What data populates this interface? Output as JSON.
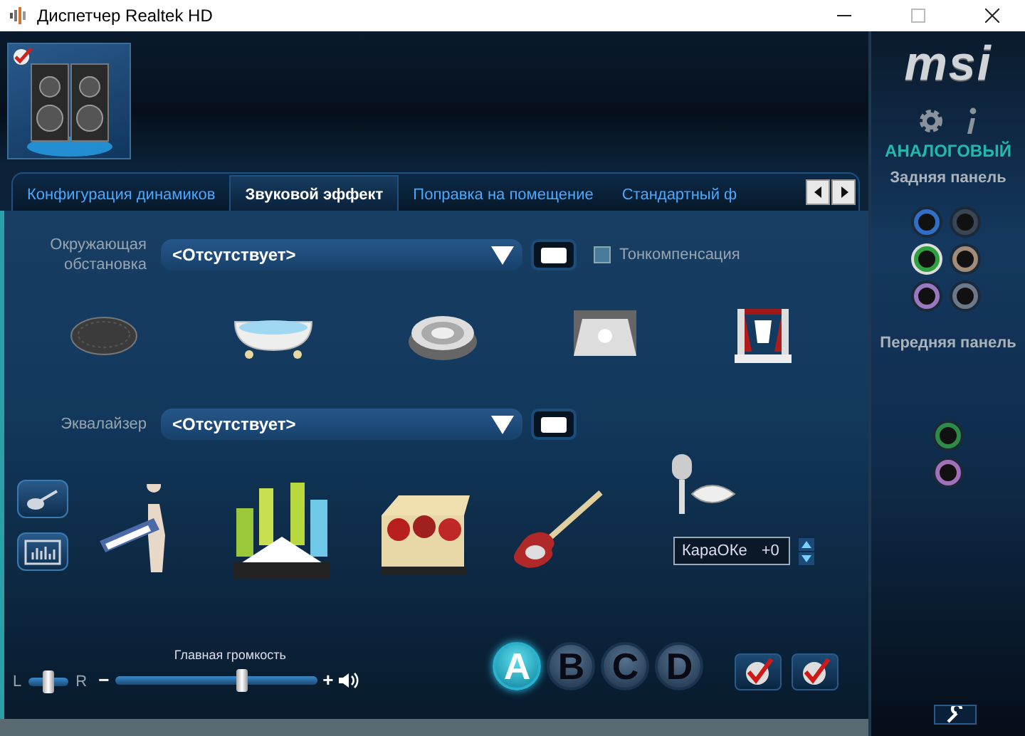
{
  "window": {
    "title": "Диспетчер Realtek HD"
  },
  "device": {
    "default_device": true
  },
  "tabs": [
    {
      "label": "Конфигурация динамиков",
      "selected": false
    },
    {
      "label": "Звуковой эффект",
      "selected": true
    },
    {
      "label": "Поправка на помещение",
      "selected": false
    },
    {
      "label": "Стандартный ф",
      "selected": false
    }
  ],
  "environment": {
    "label": "Окружающая обстановка",
    "value": "<Отсутствует>",
    "loudness": {
      "label": "Тонкомпенсация",
      "checked": false
    }
  },
  "equalizer": {
    "label": "Эквалайзер",
    "value": "<Отсутствует>"
  },
  "karaoke": {
    "label": "КараОКе",
    "value": "+0"
  },
  "volume": {
    "label": "Главная громкость",
    "left": "L",
    "right": "R",
    "balance": {
      "level": 0.5
    },
    "minus": "−",
    "plus": "+",
    "level": 0.63
  },
  "profiles": [
    {
      "label": "A",
      "selected": true
    },
    {
      "label": "B",
      "selected": false
    },
    {
      "label": "C",
      "selected": false
    },
    {
      "label": "D",
      "selected": false
    }
  ],
  "sidebar": {
    "brand": "msi",
    "title": "АНАЛОГОВЫЙ",
    "rear_label": "Задняя панель",
    "front_label": "Передняя панель",
    "rear_jacks": [
      {
        "color": "#2f6fc8",
        "plugged": false
      },
      {
        "color": "#3a4654",
        "plugged": false
      },
      {
        "color": "#2fa040",
        "plugged": true
      },
      {
        "color": "#a08c78",
        "plugged": false
      },
      {
        "color": "#9a78c0",
        "plugged": false
      },
      {
        "color": "#6c7888",
        "plugged": false
      }
    ],
    "front_jacks": [
      {
        "color": "#2f8a48",
        "plugged": false
      },
      {
        "color": "#a070b8",
        "plugged": false
      }
    ]
  }
}
